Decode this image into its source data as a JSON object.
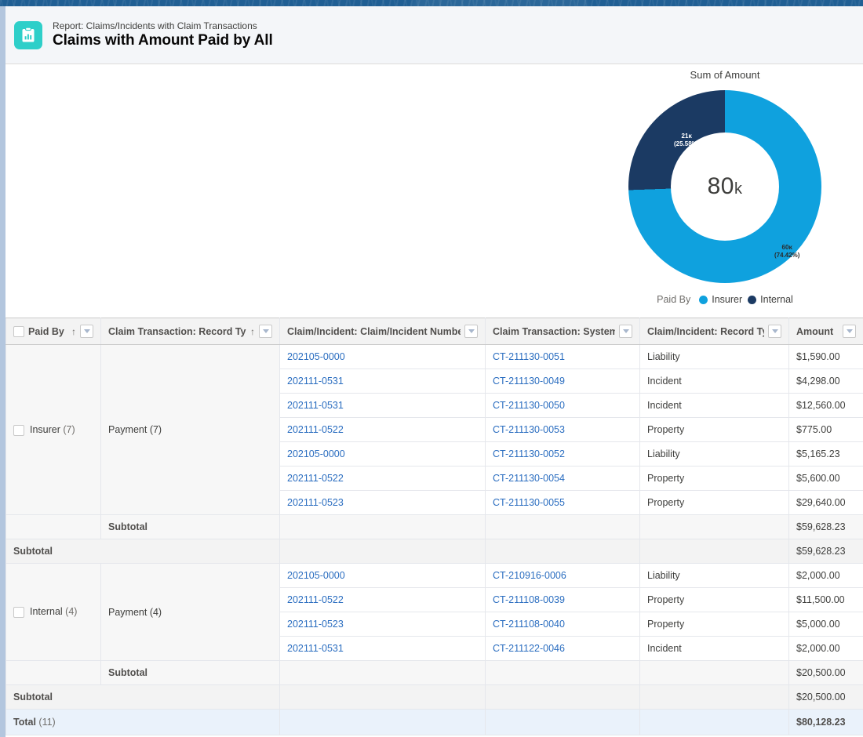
{
  "header": {
    "icon": "report-clipboard-icon",
    "eyebrow": "Report: Claims/Incidents with Claim Transactions",
    "title": "Claims with Amount Paid by All"
  },
  "chart": {
    "title": "Sum of Amount",
    "center_value": "80",
    "center_unit": "k",
    "legend_title": "Paid By",
    "slices": [
      {
        "name": "Insurer",
        "label": "60ᴋ",
        "pct_label": "(74.42%)",
        "color": "#0fa1de",
        "value": 59628.23,
        "percent": 74.42
      },
      {
        "name": "Internal",
        "label": "21ᴋ",
        "pct_label": "(25.58%)",
        "color": "#1b3a63",
        "value": 20500.0,
        "percent": 25.58
      }
    ]
  },
  "chart_data": {
    "type": "pie",
    "title": "Sum of Amount",
    "categories": [
      "Insurer",
      "Internal"
    ],
    "values": [
      59628.23,
      20500.0
    ],
    "value_labels": [
      "60ᴋ",
      "21ᴋ"
    ],
    "percent_labels": [
      "(74.42%)",
      "(25.58%)"
    ],
    "percents": [
      74.42,
      25.58
    ],
    "colors": [
      "#0fa1de",
      "#1b3a63"
    ],
    "center_label": "80ᴋ",
    "total": 80128.23,
    "legend_title": "Paid By",
    "legend_position": "bottom",
    "donut": true,
    "xlabel": "",
    "ylabel": ""
  },
  "table": {
    "columns": [
      {
        "key": "paid_by",
        "label": "Paid By",
        "checkbox": true,
        "sorted": true,
        "sort_dir": "↑",
        "menu": true,
        "align": "left"
      },
      {
        "key": "ct_rectype",
        "label": "Claim Transaction: Record Type",
        "checkbox": false,
        "sorted": true,
        "sort_dir": "↑",
        "menu": true,
        "align": "left"
      },
      {
        "key": "ci_number",
        "label": "Claim/Incident: Claim/Incident Number",
        "checkbox": false,
        "sorted": false,
        "sort_dir": "",
        "menu": true,
        "align": "left"
      },
      {
        "key": "ct_systemid",
        "label": "Claim Transaction: System ID",
        "checkbox": false,
        "sorted": false,
        "sort_dir": "",
        "menu": true,
        "align": "left"
      },
      {
        "key": "ci_rectype",
        "label": "Claim/Incident: Record Type",
        "checkbox": false,
        "sorted": false,
        "sort_dir": "",
        "menu": true,
        "align": "left"
      },
      {
        "key": "amount",
        "label": "Amount",
        "checkbox": false,
        "sorted": false,
        "sort_dir": "",
        "menu": true,
        "align": "right"
      }
    ],
    "groups": [
      {
        "paid_by_label": "Insurer",
        "paid_by_count": "(7)",
        "record_type_label": "Payment",
        "record_type_count": "(7)",
        "rows": [
          {
            "ci_number": "202105-0000",
            "ct_systemid": "CT-211130-0051",
            "ci_rectype": "Liability",
            "amount": "$1,590.00"
          },
          {
            "ci_number": "202111-0531",
            "ct_systemid": "CT-211130-0049",
            "ci_rectype": "Incident",
            "amount": "$4,298.00"
          },
          {
            "ci_number": "202111-0531",
            "ct_systemid": "CT-211130-0050",
            "ci_rectype": "Incident",
            "amount": "$12,560.00"
          },
          {
            "ci_number": "202111-0522",
            "ct_systemid": "CT-211130-0053",
            "ci_rectype": "Property",
            "amount": "$775.00"
          },
          {
            "ci_number": "202105-0000",
            "ct_systemid": "CT-211130-0052",
            "ci_rectype": "Liability",
            "amount": "$5,165.23"
          },
          {
            "ci_number": "202111-0522",
            "ct_systemid": "CT-211130-0054",
            "ci_rectype": "Property",
            "amount": "$5,600.00"
          },
          {
            "ci_number": "202111-0523",
            "ct_systemid": "CT-211130-0055",
            "ci_rectype": "Property",
            "amount": "$29,640.00"
          }
        ],
        "inner_subtotal_label": "Subtotal",
        "inner_subtotal_amount": "$59,628.23",
        "outer_subtotal_label": "Subtotal",
        "outer_subtotal_amount": "$59,628.23"
      },
      {
        "paid_by_label": "Internal",
        "paid_by_count": "(4)",
        "record_type_label": "Payment",
        "record_type_count": "(4)",
        "rows": [
          {
            "ci_number": "202105-0000",
            "ct_systemid": "CT-210916-0006",
            "ci_rectype": "Liability",
            "amount": "$2,000.00"
          },
          {
            "ci_number": "202111-0522",
            "ct_systemid": "CT-211108-0039",
            "ci_rectype": "Property",
            "amount": "$11,500.00"
          },
          {
            "ci_number": "202111-0523",
            "ct_systemid": "CT-211108-0040",
            "ci_rectype": "Property",
            "amount": "$5,000.00"
          },
          {
            "ci_number": "202111-0531",
            "ct_systemid": "CT-211122-0046",
            "ci_rectype": "Incident",
            "amount": "$2,000.00"
          }
        ],
        "inner_subtotal_label": "Subtotal",
        "inner_subtotal_amount": "$20,500.00",
        "outer_subtotal_label": "Subtotal",
        "outer_subtotal_amount": "$20,500.00"
      }
    ],
    "grand_total": {
      "label": "Total",
      "count": "(11)",
      "amount": "$80,128.23"
    }
  }
}
